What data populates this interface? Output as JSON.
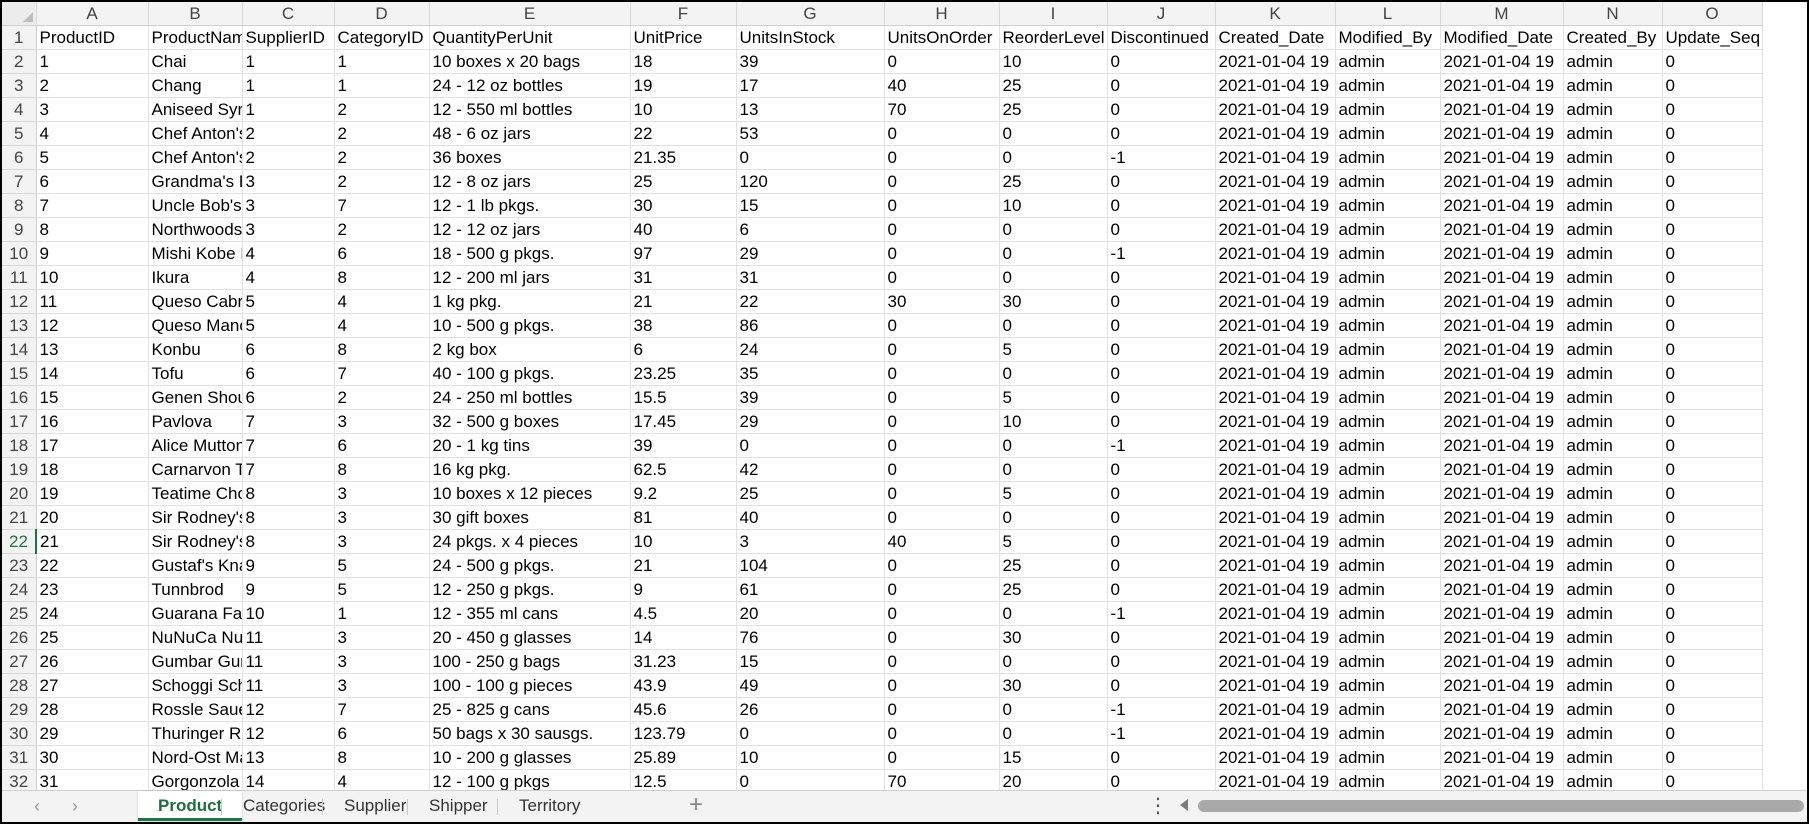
{
  "columns": [
    "A",
    "B",
    "C",
    "D",
    "E",
    "F",
    "G",
    "H",
    "I",
    "J",
    "K",
    "L",
    "M",
    "N",
    "O"
  ],
  "fields": [
    "ProductID",
    "ProductName",
    "SupplierID",
    "CategoryID",
    "QuantityPerUnit",
    "UnitPrice",
    "UnitsInStock",
    "UnitsOnOrder",
    "ReorderLevel",
    "Discontinued",
    "Created_Date",
    "Modified_By",
    "Modified_Date",
    "Created_By",
    "Update_Seq"
  ],
  "rows": [
    [
      "1",
      "Chai",
      "1",
      "1",
      "10 boxes x 20 bags",
      "18",
      "39",
      "0",
      "10",
      "0",
      "2021-01-04 19",
      "admin",
      "2021-01-04 19",
      "admin",
      "0"
    ],
    [
      "2",
      "Chang",
      "1",
      "1",
      "24 - 12 oz bottles",
      "19",
      "17",
      "40",
      "25",
      "0",
      "2021-01-04 19",
      "admin",
      "2021-01-04 19",
      "admin",
      "0"
    ],
    [
      "3",
      "Aniseed Syrup",
      "1",
      "2",
      "12 - 550 ml bottles",
      "10",
      "13",
      "70",
      "25",
      "0",
      "2021-01-04 19",
      "admin",
      "2021-01-04 19",
      "admin",
      "0"
    ],
    [
      "4",
      "Chef Anton's Ca",
      "2",
      "2",
      "48 - 6 oz jars",
      "22",
      "53",
      "0",
      "0",
      "0",
      "2021-01-04 19",
      "admin",
      "2021-01-04 19",
      "admin",
      "0"
    ],
    [
      "5",
      "Chef Anton's Gu",
      "2",
      "2",
      "36 boxes",
      "21.35",
      "0",
      "0",
      "0",
      "-1",
      "2021-01-04 19",
      "admin",
      "2021-01-04 19",
      "admin",
      "0"
    ],
    [
      "6",
      "Grandma's Boys",
      "3",
      "2",
      "12 - 8 oz jars",
      "25",
      "120",
      "0",
      "25",
      "0",
      "2021-01-04 19",
      "admin",
      "2021-01-04 19",
      "admin",
      "0"
    ],
    [
      "7",
      "Uncle Bob's Org",
      "3",
      "7",
      "12 - 1 lb pkgs.",
      "30",
      "15",
      "0",
      "10",
      "0",
      "2021-01-04 19",
      "admin",
      "2021-01-04 19",
      "admin",
      "0"
    ],
    [
      "8",
      "Northwoods Cr",
      "3",
      "2",
      "12 - 12 oz jars",
      "40",
      "6",
      "0",
      "0",
      "0",
      "2021-01-04 19",
      "admin",
      "2021-01-04 19",
      "admin",
      "0"
    ],
    [
      "9",
      "Mishi Kobe Niku",
      "4",
      "6",
      "18 - 500 g pkgs.",
      "97",
      "29",
      "0",
      "0",
      "-1",
      "2021-01-04 19",
      "admin",
      "2021-01-04 19",
      "admin",
      "0"
    ],
    [
      "10",
      "Ikura",
      "4",
      "8",
      "12 - 200 ml jars",
      "31",
      "31",
      "0",
      "0",
      "0",
      "2021-01-04 19",
      "admin",
      "2021-01-04 19",
      "admin",
      "0"
    ],
    [
      "11",
      "Queso Cabrales",
      "5",
      "4",
      "1 kg pkg.",
      "21",
      "22",
      "30",
      "30",
      "0",
      "2021-01-04 19",
      "admin",
      "2021-01-04 19",
      "admin",
      "0"
    ],
    [
      "12",
      "Queso Manchego",
      "5",
      "4",
      "10 - 500 g pkgs.",
      "38",
      "86",
      "0",
      "0",
      "0",
      "2021-01-04 19",
      "admin",
      "2021-01-04 19",
      "admin",
      "0"
    ],
    [
      "13",
      "Konbu",
      "6",
      "8",
      "2 kg box",
      "6",
      "24",
      "0",
      "5",
      "0",
      "2021-01-04 19",
      "admin",
      "2021-01-04 19",
      "admin",
      "0"
    ],
    [
      "14",
      "Tofu",
      "6",
      "7",
      "40 - 100 g pkgs.",
      "23.25",
      "35",
      "0",
      "0",
      "0",
      "2021-01-04 19",
      "admin",
      "2021-01-04 19",
      "admin",
      "0"
    ],
    [
      "15",
      "Genen Shouyu",
      "6",
      "2",
      "24 - 250 ml bottles",
      "15.5",
      "39",
      "0",
      "5",
      "0",
      "2021-01-04 19",
      "admin",
      "2021-01-04 19",
      "admin",
      "0"
    ],
    [
      "16",
      "Pavlova",
      "7",
      "3",
      "32 - 500 g boxes",
      "17.45",
      "29",
      "0",
      "10",
      "0",
      "2021-01-04 19",
      "admin",
      "2021-01-04 19",
      "admin",
      "0"
    ],
    [
      "17",
      "Alice Mutton",
      "7",
      "6",
      "20 - 1 kg tins",
      "39",
      "0",
      "0",
      "0",
      "-1",
      "2021-01-04 19",
      "admin",
      "2021-01-04 19",
      "admin",
      "0"
    ],
    [
      "18",
      "Carnarvon Tiger",
      "7",
      "8",
      "16 kg pkg.",
      "62.5",
      "42",
      "0",
      "0",
      "0",
      "2021-01-04 19",
      "admin",
      "2021-01-04 19",
      "admin",
      "0"
    ],
    [
      "19",
      "Teatime Chocola",
      "8",
      "3",
      "10 boxes x 12 pieces",
      "9.2",
      "25",
      "0",
      "5",
      "0",
      "2021-01-04 19",
      "admin",
      "2021-01-04 19",
      "admin",
      "0"
    ],
    [
      "20",
      "Sir Rodney's Ma",
      "8",
      "3",
      "30 gift boxes",
      "81",
      "40",
      "0",
      "0",
      "0",
      "2021-01-04 19",
      "admin",
      "2021-01-04 19",
      "admin",
      "0"
    ],
    [
      "21",
      "Sir Rodney's Sco",
      "8",
      "3",
      "24 pkgs. x 4 pieces",
      "10",
      "3",
      "40",
      "5",
      "0",
      "2021-01-04 19",
      "admin",
      "2021-01-04 19",
      "admin",
      "0"
    ],
    [
      "22",
      "Gustaf's Knacke",
      "9",
      "5",
      "24 - 500 g pkgs.",
      "21",
      "104",
      "0",
      "25",
      "0",
      "2021-01-04 19",
      "admin",
      "2021-01-04 19",
      "admin",
      "0"
    ],
    [
      "23",
      "Tunnbrod",
      "9",
      "5",
      "12 - 250 g pkgs.",
      "9",
      "61",
      "0",
      "25",
      "0",
      "2021-01-04 19",
      "admin",
      "2021-01-04 19",
      "admin",
      "0"
    ],
    [
      "24",
      "Guarana Fantas",
      "10",
      "1",
      "12 - 355 ml cans",
      "4.5",
      "20",
      "0",
      "0",
      "-1",
      "2021-01-04 19",
      "admin",
      "2021-01-04 19",
      "admin",
      "0"
    ],
    [
      "25",
      "NuNuCa Nub-Nu",
      "11",
      "3",
      "20 - 450 g glasses",
      "14",
      "76",
      "0",
      "30",
      "0",
      "2021-01-04 19",
      "admin",
      "2021-01-04 19",
      "admin",
      "0"
    ],
    [
      "26",
      "Gumbar Gummi",
      "11",
      "3",
      "100 - 250 g bags",
      "31.23",
      "15",
      "0",
      "0",
      "0",
      "2021-01-04 19",
      "admin",
      "2021-01-04 19",
      "admin",
      "0"
    ],
    [
      "27",
      "Schoggi Schoko",
      "11",
      "3",
      "100 - 100 g pieces",
      "43.9",
      "49",
      "0",
      "30",
      "0",
      "2021-01-04 19",
      "admin",
      "2021-01-04 19",
      "admin",
      "0"
    ],
    [
      "28",
      "Rossle Sauerkra",
      "12",
      "7",
      "25 - 825 g cans",
      "45.6",
      "26",
      "0",
      "0",
      "-1",
      "2021-01-04 19",
      "admin",
      "2021-01-04 19",
      "admin",
      "0"
    ],
    [
      "29",
      "Thuringer Rostb",
      "12",
      "6",
      "50 bags x 30 sausgs.",
      "123.79",
      "0",
      "0",
      "0",
      "-1",
      "2021-01-04 19",
      "admin",
      "2021-01-04 19",
      "admin",
      "0"
    ],
    [
      "30",
      "Nord-Ost Matje",
      "13",
      "8",
      "10 - 200 g glasses",
      "25.89",
      "10",
      "0",
      "15",
      "0",
      "2021-01-04 19",
      "admin",
      "2021-01-04 19",
      "admin",
      "0"
    ],
    [
      "31",
      "Gorgonzola Teli",
      "14",
      "4",
      "12 - 100 g pkgs",
      "12.5",
      "0",
      "70",
      "20",
      "0",
      "2021-01-04 19",
      "admin",
      "2021-01-04 19",
      "admin",
      "0"
    ]
  ],
  "active_row": 22,
  "sheet_tabs": [
    "Product",
    "Categories",
    "Supplier",
    "Shipper",
    "Territory"
  ],
  "active_tab": "Product",
  "accent_color": "#217346"
}
